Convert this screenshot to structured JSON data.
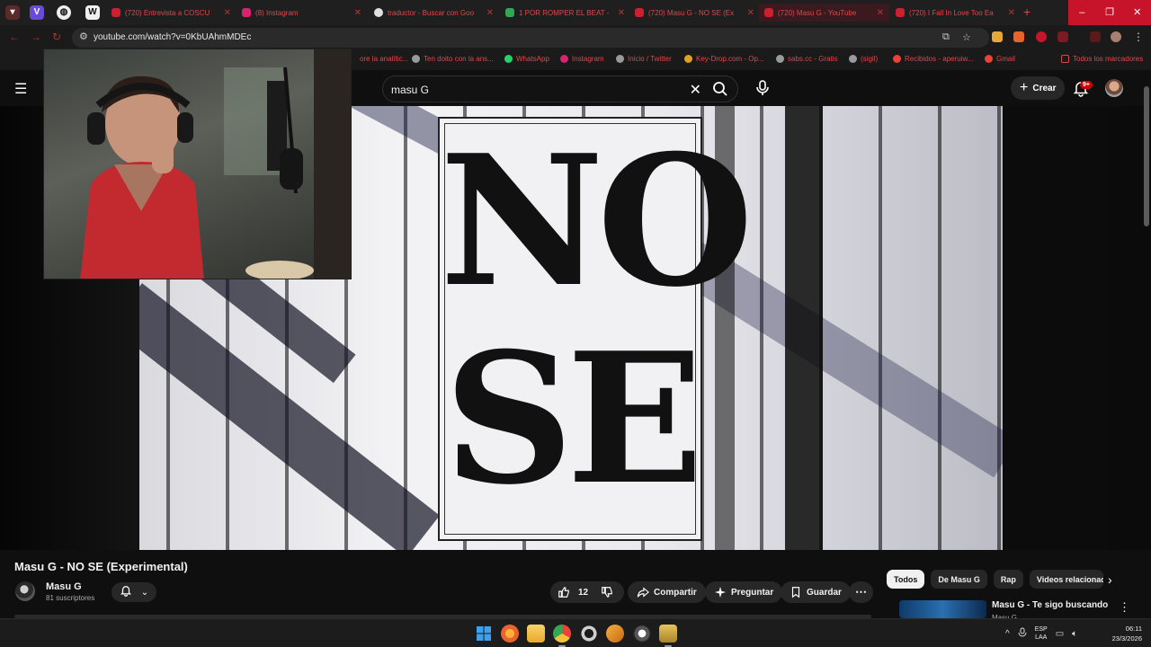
{
  "browser": {
    "tabs": [
      {
        "label": "(720) Entrevista a COSCU",
        "favicon_color": "#cc1f2f",
        "active": false
      },
      {
        "label": "(8) Instagram",
        "favicon_color": "#d6246e",
        "active": false
      },
      {
        "label": "traductor - Buscar con Goo",
        "favicon_color": "#e0e0e0",
        "active": false
      },
      {
        "label": "1 POR ROMPER EL BEAT -",
        "favicon_color": "#33a852",
        "active": false
      },
      {
        "label": "(720) Masu G - NO SE (Ex",
        "favicon_color": "#cc1f2f",
        "active": true
      },
      {
        "label": "(720) Masu G - YouTube",
        "favicon_color": "#cc1f2f",
        "active": false
      },
      {
        "label": "(720) I Fall In Love Too Ea",
        "favicon_color": "#cc1f2f",
        "active": false
      }
    ],
    "new_tab": "+",
    "window_controls": [
      "–",
      "❐",
      "✕"
    ],
    "url": "youtube.com/watch?v=0KbUAhmMDEc",
    "bookmarks": [
      {
        "label": "Ten doito con la ans...",
        "color": "#9a9a9a"
      },
      {
        "label": "WhatsApp",
        "color": "#25d366"
      },
      {
        "label": "Instagram",
        "color": "#d6246e"
      },
      {
        "label": "Inicio / Twitter",
        "color": "#9a9a9a"
      },
      {
        "label": "Key-Drop.com - Op...",
        "color": "#e0a020"
      },
      {
        "label": "sabs.cc - Gratis",
        "color": "#9a9a9a"
      },
      {
        "label": "(sigil)",
        "color": "#9a9a9a"
      },
      {
        "label": "Recibidos - aperuiw...",
        "color": "#ea4335"
      },
      {
        "label": "Gmail",
        "color": "#ea4335"
      }
    ],
    "bookmark_left_label": "ore la analític...",
    "all_bookmarks": "Todos los marcadores"
  },
  "youtube": {
    "search_query": "masu G",
    "create_label": "Crear",
    "notifications_badge": "9+",
    "video": {
      "poster_text_line1": "NO",
      "poster_text_line2": "SE",
      "title": "Masu G - NO SE (Experimental)",
      "channel": "Masu G",
      "subscribers": "81 suscriptores",
      "likes": "12",
      "share_label": "Compartir",
      "ask_label": "Preguntar",
      "save_label": "Guardar"
    },
    "chips": [
      "Todos",
      "De Masu G",
      "Rap",
      "Videos relacionad"
    ],
    "recommendation": {
      "title": "Masu G - Te sigo buscando",
      "channel": "Masu G"
    }
  },
  "taskbar": {
    "apps": [
      {
        "name": "start",
        "color": "#3aa0f0"
      },
      {
        "name": "firefox",
        "color": "#e8642a"
      },
      {
        "name": "file-explorer",
        "color": "#f3c23a"
      },
      {
        "name": "chrome",
        "color": "#e8453a"
      },
      {
        "name": "obs",
        "color": "#bfbfbf"
      },
      {
        "name": "app-lightning",
        "color": "#e3a12b"
      },
      {
        "name": "media-player",
        "color": "#dcdcdc"
      },
      {
        "name": "app-extra",
        "color": "#d8b24a"
      }
    ],
    "tray_arrow": "^",
    "lang_line1": "ESP",
    "lang_line2": "LAA",
    "time": "06:11",
    "date": "23/3/2026"
  }
}
